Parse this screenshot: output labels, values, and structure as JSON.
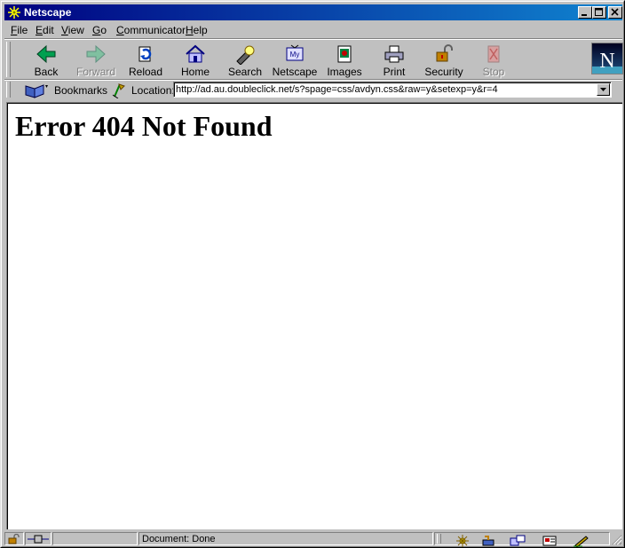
{
  "window": {
    "title": "Netscape"
  },
  "menu": [
    {
      "label": "File",
      "accel": "F",
      "rest": "ile"
    },
    {
      "label": "Edit",
      "accel": "E",
      "rest": "dit"
    },
    {
      "label": "View",
      "accel": "V",
      "rest": "iew"
    },
    {
      "label": "Go",
      "accel": "G",
      "rest": "o"
    },
    {
      "label": "Communicator",
      "accel": "C",
      "rest": "ommunicator"
    },
    {
      "label": "Help",
      "accel": "H",
      "rest": "elp"
    }
  ],
  "toolbar": {
    "back": "Back",
    "forward": "Forward",
    "reload": "Reload",
    "home": "Home",
    "search": "Search",
    "netscape": "Netscape",
    "images": "Images",
    "print": "Print",
    "security": "Security",
    "stop": "Stop"
  },
  "location_bar": {
    "bookmarks": "Bookmarks",
    "location_label": "Location:",
    "url": "http://ad.au.doubleclick.net/s?spage=css/avdyn.css&raw=y&setexp=y&r=4"
  },
  "page": {
    "heading": "Error 404 Not Found"
  },
  "status": {
    "text": "Document: Done"
  },
  "icons": {
    "app": "netscape-lighthouse-icon",
    "netscape_logo_letter": "N"
  }
}
